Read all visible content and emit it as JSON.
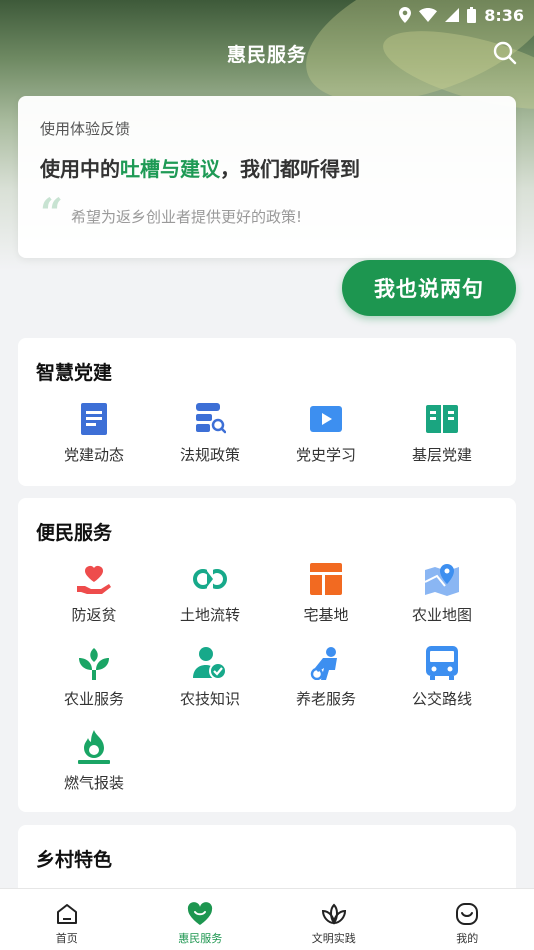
{
  "status": {
    "time": "8:36"
  },
  "header": {
    "title": "惠民服务"
  },
  "feedback": {
    "label": "使用体验反馈",
    "headline_pre": "使用中的",
    "headline_highlight": "吐槽与建议",
    "headline_post": "，我们都听得到",
    "quote": "希望为返乡创业者提供更好的政策!",
    "button": "我也说两句"
  },
  "smart_party": {
    "title": "智慧党建",
    "items": [
      {
        "label": "党建动态",
        "icon": "news-icon",
        "color": "#3d6fd6"
      },
      {
        "label": "法规政策",
        "icon": "law-search-icon",
        "color": "#3d6fd6"
      },
      {
        "label": "党史学习",
        "icon": "video-play-icon",
        "color": "#3d8ff0"
      },
      {
        "label": "基层党建",
        "icon": "book-icon",
        "color": "#1aa580"
      }
    ]
  },
  "services": {
    "title": "便民服务",
    "items": [
      {
        "label": "防返贫",
        "icon": "heart-hand-icon",
        "color": "#ee4c4c"
      },
      {
        "label": "土地流转",
        "icon": "transfer-icon",
        "color": "#17a98a"
      },
      {
        "label": "宅基地",
        "icon": "layout-icon",
        "color": "#f26a21"
      },
      {
        "label": "农业地图",
        "icon": "map-pin-icon",
        "color": "#3d8ff0"
      },
      {
        "label": "农业服务",
        "icon": "sprout-icon",
        "color": "#1aa565"
      },
      {
        "label": "农技知识",
        "icon": "expert-icon",
        "color": "#17a98a"
      },
      {
        "label": "养老服务",
        "icon": "elderly-icon",
        "color": "#3d8ff0"
      },
      {
        "label": "公交路线",
        "icon": "bus-icon",
        "color": "#3d8ff0"
      },
      {
        "label": "燃气报装",
        "icon": "gas-flame-icon",
        "color": "#1aa565"
      }
    ]
  },
  "rural": {
    "title": "乡村特色"
  },
  "tabs": [
    {
      "label": "首页",
      "icon": "home-icon"
    },
    {
      "label": "惠民服务",
      "icon": "heart-icon"
    },
    {
      "label": "文明实践",
      "icon": "lotus-icon"
    },
    {
      "label": "我的",
      "icon": "smile-icon"
    }
  ],
  "colors": {
    "accent": "#1d9650"
  }
}
